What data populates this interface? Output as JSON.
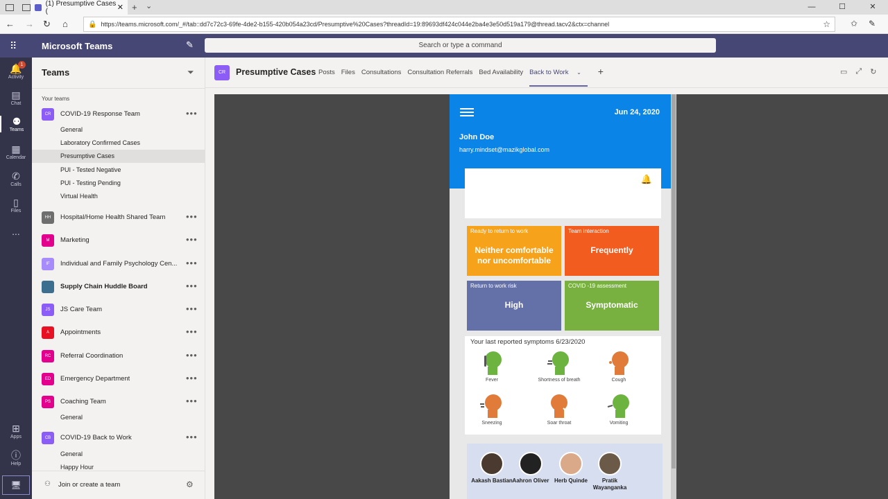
{
  "browser": {
    "tab_title": "(1) Presumptive Cases (",
    "url": "https://teams.microsoft.com/_#/tab::dd7c72c3-69fe-4de2-b155-420b054a23cd/Presumptive%20Cases?threadId=19:89693df424c044e2ba4e3e50d519a179@thread.tacv2&ctx=channel"
  },
  "app": {
    "title": "Microsoft Teams",
    "search_placeholder": "Search or type a command"
  },
  "rail": {
    "items": [
      {
        "label": "Activity",
        "badge": "1"
      },
      {
        "label": "Chat"
      },
      {
        "label": "Teams"
      },
      {
        "label": "Calendar"
      },
      {
        "label": "Calls"
      },
      {
        "label": "Files"
      },
      {
        "label": "..."
      },
      {
        "label": "Apps"
      },
      {
        "label": "Help"
      }
    ]
  },
  "sidebar": {
    "title": "Teams",
    "section": "Your teams",
    "teams": [
      {
        "initials": "CR",
        "name": "COVID-19 Response Team",
        "color": "#8b5cf6"
      },
      {
        "initials": "HH",
        "name": "Hospital/Home Health Shared Team",
        "color": "#6e6e6e"
      },
      {
        "initials": "M",
        "name": "Marketing",
        "color": "#e3008c"
      },
      {
        "initials": "IF",
        "name": "Individual and Family Psychology Cen...",
        "color": "#a78bfa"
      },
      {
        "initials": "",
        "name": "Supply Chain Huddle Board",
        "color": "#3b6e8f"
      },
      {
        "initials": "JS",
        "name": "JS Care Team",
        "color": "#8b5cf6"
      },
      {
        "initials": "A",
        "name": "Appointments",
        "color": "#e81123"
      },
      {
        "initials": "RC",
        "name": "Referral Coordination",
        "color": "#e3008c"
      },
      {
        "initials": "ED",
        "name": "Emergency Department",
        "color": "#e3008c"
      },
      {
        "initials": "PS",
        "name": "Coaching Team",
        "color": "#e3008c"
      },
      {
        "initials": "CB",
        "name": "COVID-19 Back to Work",
        "color": "#8b5cf6"
      }
    ],
    "channels_covid": [
      "General",
      "Laboratory Confirmed Cases",
      "Presumptive Cases",
      "PUI - Tested Negative",
      "PUI - Testing Pending",
      "Virtual Health"
    ],
    "channels_coaching": [
      "General"
    ],
    "channels_backtowork": [
      "General",
      "Happy Hour"
    ],
    "join_label": "Join or create a team"
  },
  "channel": {
    "initials": "CR",
    "name": "Presumptive Cases",
    "tabs": [
      "Posts",
      "Files",
      "Consultations",
      "Consultation Referrals",
      "Bed Availability",
      "Back to Work"
    ],
    "active_tab": "Back to Work"
  },
  "app_panel": {
    "date": "Jun 24, 2020",
    "user_name": "John Doe",
    "user_email": "harry.mindset@mazikglobal.com",
    "tiles": [
      {
        "label": "Ready to return to work",
        "value": "Neither comfortable nor uncomfortable",
        "color": "#f7a21b"
      },
      {
        "label": "Team interaction",
        "value": "Frequently",
        "color": "#f25c1e"
      },
      {
        "label": "Return to work risk",
        "value": "High",
        "color": "#6470a8"
      },
      {
        "label": "COVID -19 assessment",
        "value": "Symptomatic",
        "color": "#78b13f"
      }
    ],
    "symptoms_title": "Your last reported symptoms 6/23/2020",
    "symptoms": [
      {
        "label": "Fever",
        "color": "#6cb33f"
      },
      {
        "label": "Shortness of breath",
        "color": "#6cb33f"
      },
      {
        "label": "Cough",
        "color": "#e07b39"
      },
      {
        "label": "Sneezing",
        "color": "#e07b39"
      },
      {
        "label": "Soar throat",
        "color": "#e07b39"
      },
      {
        "label": "Vomiting",
        "color": "#6cb33f"
      }
    ],
    "people": [
      {
        "name": "Aakash Bastian"
      },
      {
        "name": "Aahron Oliver"
      },
      {
        "name": "Herb Quinde"
      },
      {
        "name": "Pratik Wayanganka"
      }
    ]
  }
}
